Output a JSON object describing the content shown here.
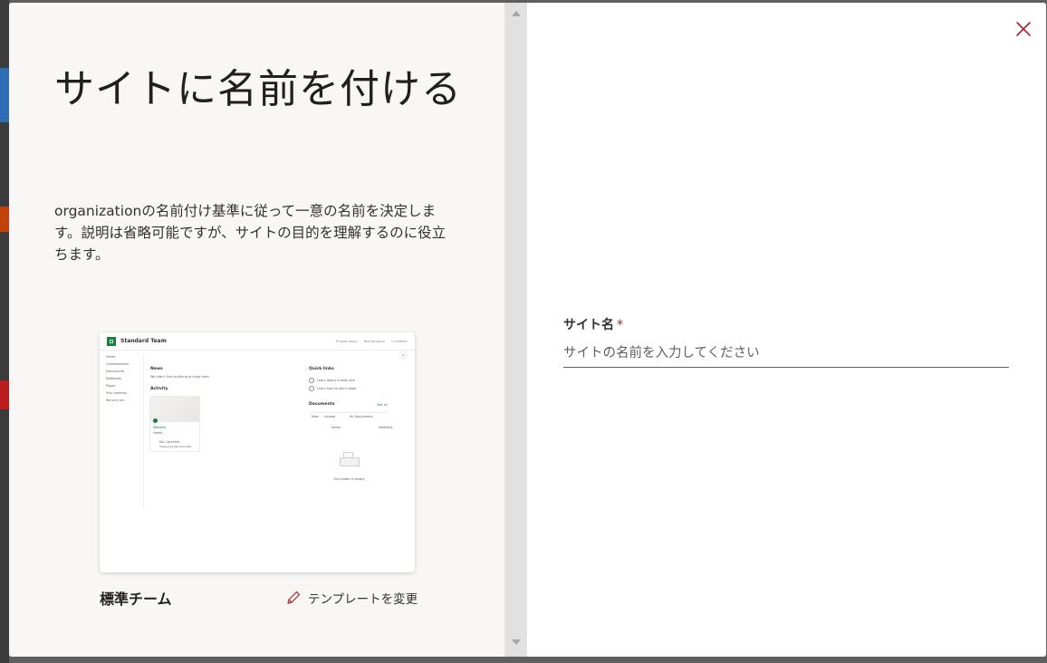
{
  "panel": {
    "heading": "サイトに名前を付ける",
    "description": "organizationの名前付け基準に従って一意の名前を決定します。説明は省略可能ですが、サイトの目的を理解するのに役立ちます。"
  },
  "preview": {
    "site_title": "Standard Team",
    "top_actions": [
      "Private group",
      "Not following",
      "1 member"
    ],
    "nav_items": [
      "Home",
      "Conversations",
      "Documents",
      "Notebook",
      "Pages",
      "Site contents",
      "Recycle bin"
    ],
    "news_title": "News",
    "news_empty": "We didn't find anything to show here.",
    "activity_title": "Activity",
    "activity_card_title": "Website",
    "activity_card_sub": "Home",
    "activity_person": "Kai Carvalho",
    "activity_person_sub": "Viewed by Kai Carvalho",
    "quicklinks_title": "Quick links",
    "quicklinks": [
      "Learn about a team site",
      "Learn how to add a page"
    ],
    "documents_title": "Documents",
    "documents_see_all": "See all",
    "documents_actions": [
      "New",
      "Upload",
      "All Documents"
    ],
    "documents_columns": [
      "Name",
      "Modified"
    ],
    "empty_folder": "This folder is empty"
  },
  "template": {
    "name": "標準チーム",
    "change_label": "テンプレートを変更"
  },
  "form": {
    "site_name_label": "サイト名",
    "required_marker": "*",
    "site_name_placeholder": "サイトの名前を入力してください"
  },
  "colors": {
    "accent_red": "#a4262c",
    "left_pane_bg": "#f8f7f6",
    "preview_logo": "#1d7e3e"
  },
  "icons": {
    "close": "close-icon",
    "edit": "pencil-icon"
  }
}
